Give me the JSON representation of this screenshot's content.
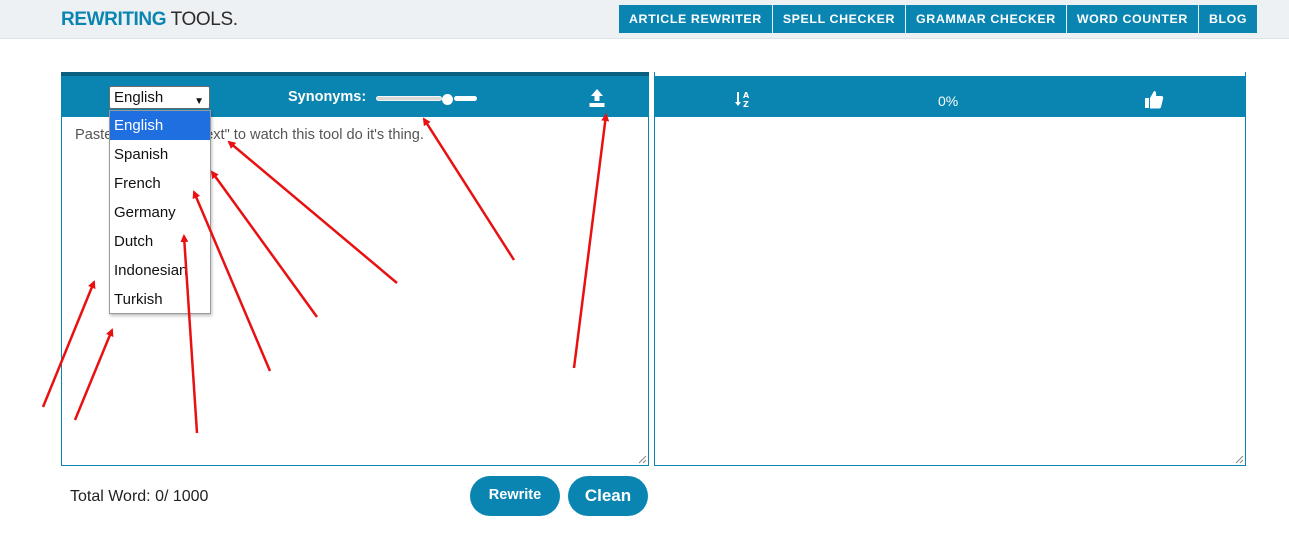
{
  "header": {
    "logo_bold": "REWRITING",
    "logo_thin": " TOOLS.",
    "nav": [
      "ARTICLE REWRITER",
      "SPELL CHECKER",
      "GRAMMAR CHECKER",
      "WORD COUNTER",
      "BLOG"
    ]
  },
  "left_panel": {
    "language_selected": "English",
    "synonyms_label": "Synonyms:",
    "synonyms_level_fraction": 0.7,
    "placeholder": "Paste          e and click \"Next\" to watch this tool do it's thing."
  },
  "dropdown": {
    "options": [
      "English",
      "Spanish",
      "French",
      "Germany",
      "Dutch",
      "Indonesian",
      "Turkish"
    ],
    "selected_index": 0
  },
  "right_panel": {
    "percent": "0%"
  },
  "footer": {
    "total_words": "Total Word: 0/ 1000",
    "rewrite_label": "Rewrite",
    "clean_label": "Clean"
  },
  "colors": {
    "brand": "#0a85b1",
    "annotation": "#e81010",
    "selected_option": "#1f6fe0"
  },
  "icons": {
    "upload": "upload-icon",
    "sort": "sort-az-icon",
    "like": "thumbs-up-icon"
  }
}
